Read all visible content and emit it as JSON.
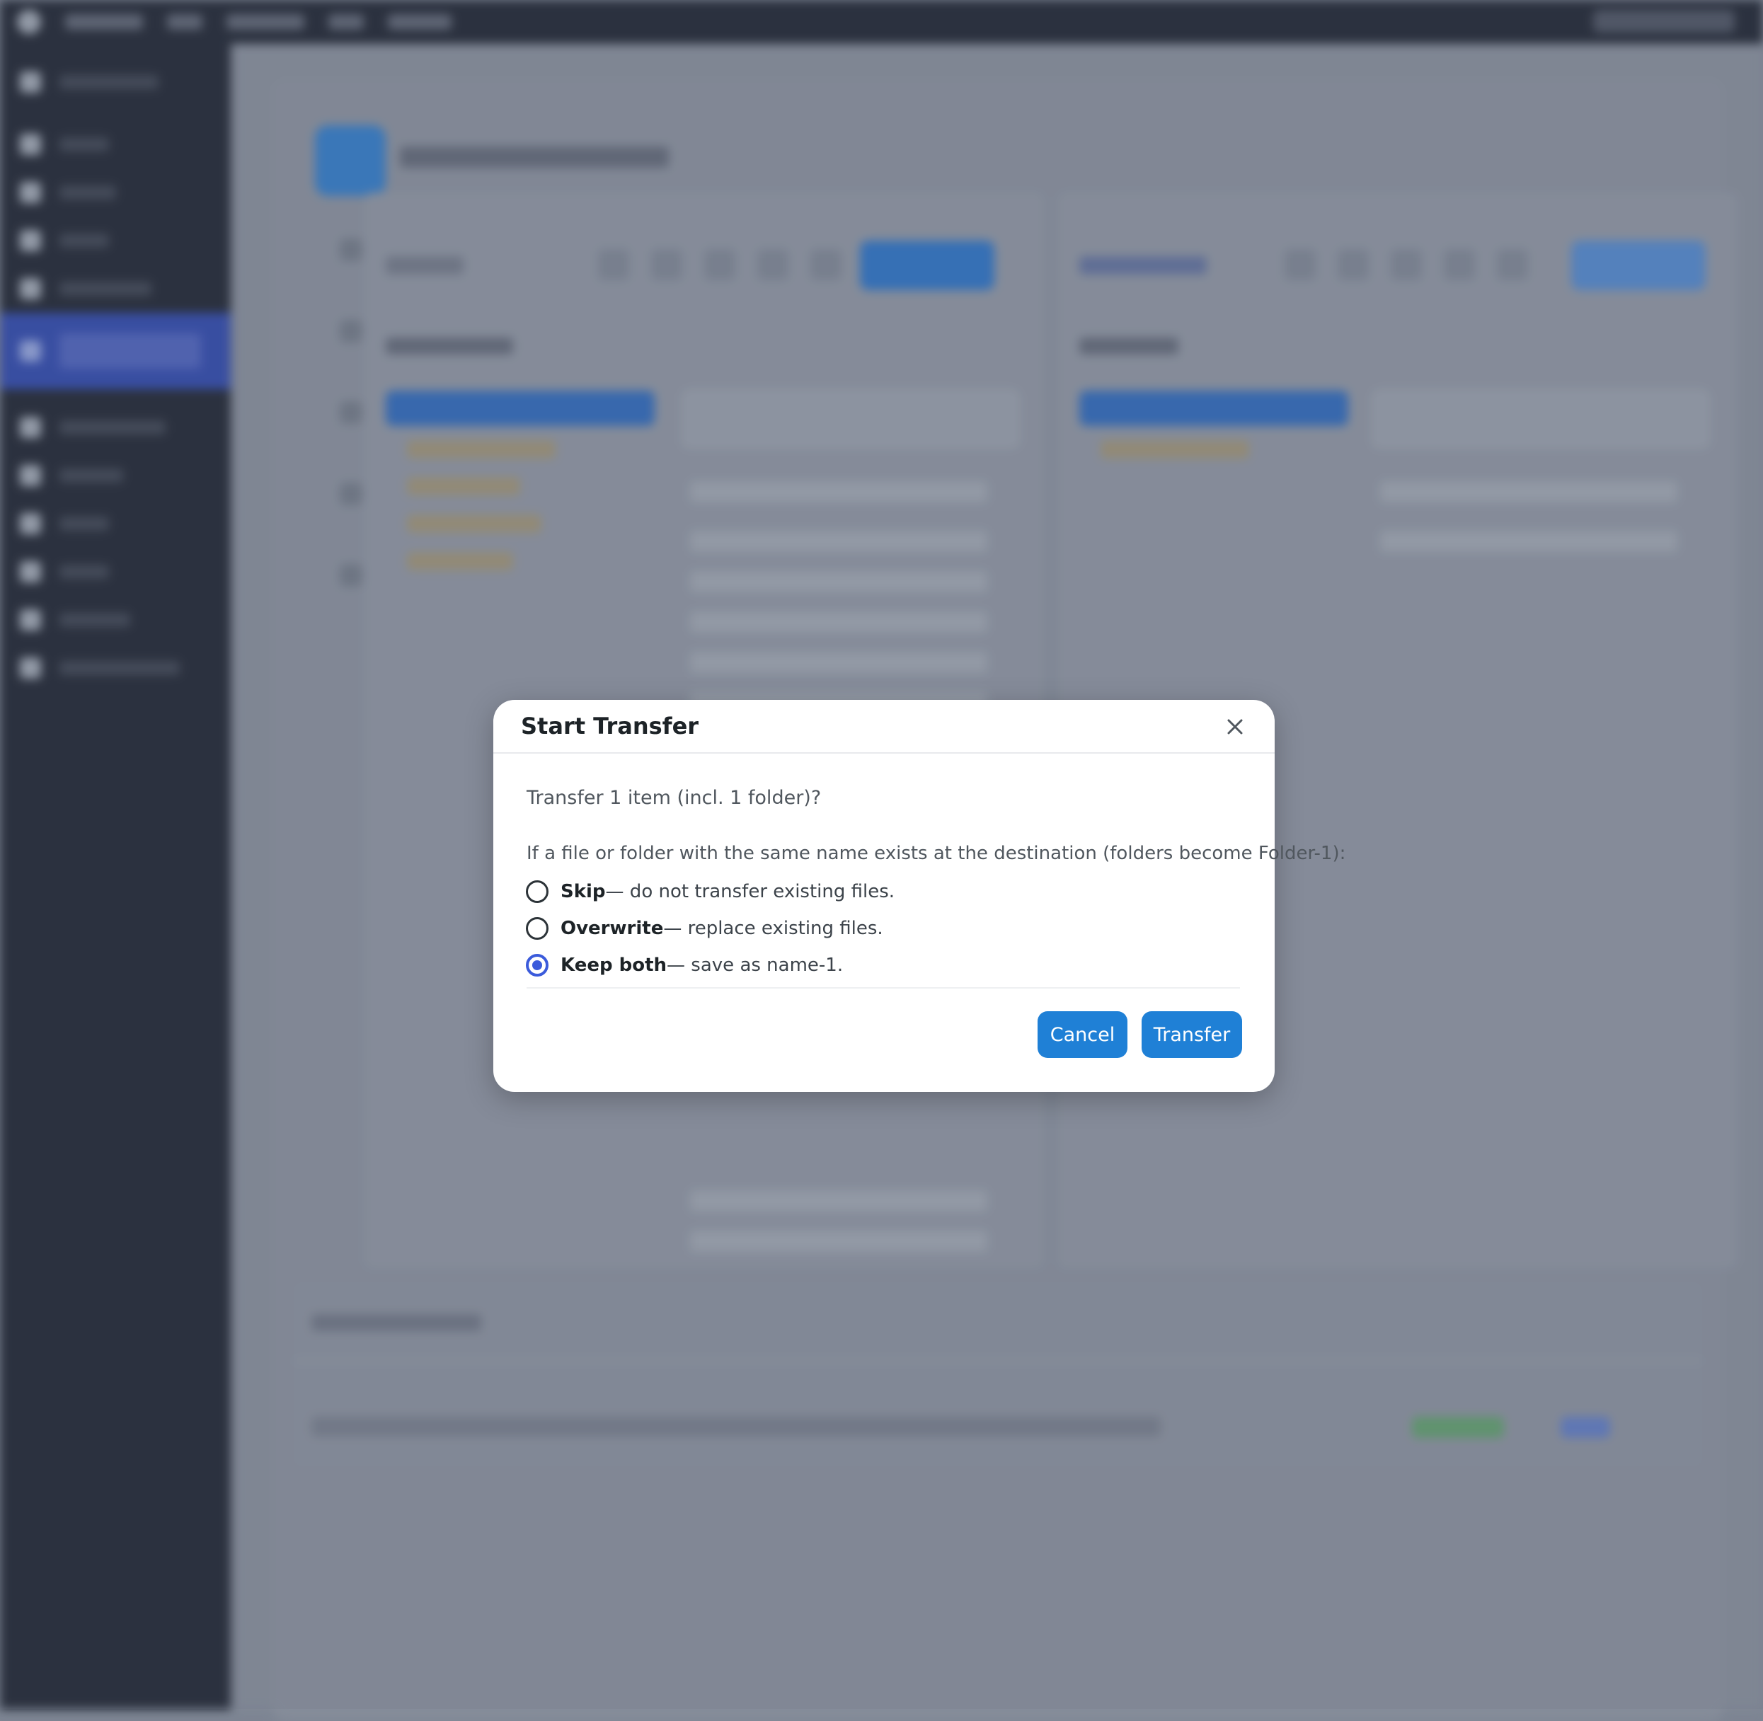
{
  "modal": {
    "title": "Start Transfer",
    "question": "Transfer 1 item (incl. 1 folder)?",
    "conflict_prompt": "If a file or folder with the same name exists at the destination (folders become Folder-1):",
    "options": [
      {
        "name": "Skip",
        "description": " — do not transfer existing files.",
        "selected": false
      },
      {
        "name": "Overwrite",
        "description": " — replace existing files.",
        "selected": false
      },
      {
        "name": "Keep both",
        "description": " — save as name-1.",
        "selected": true
      }
    ],
    "cancel_label": "Cancel",
    "transfer_label": "Transfer"
  },
  "icons": {
    "close": "close-icon"
  },
  "colors": {
    "accent": "#1f80d6",
    "radio_selected": "#3b5bdb",
    "admin_dark": "#1d2330"
  }
}
